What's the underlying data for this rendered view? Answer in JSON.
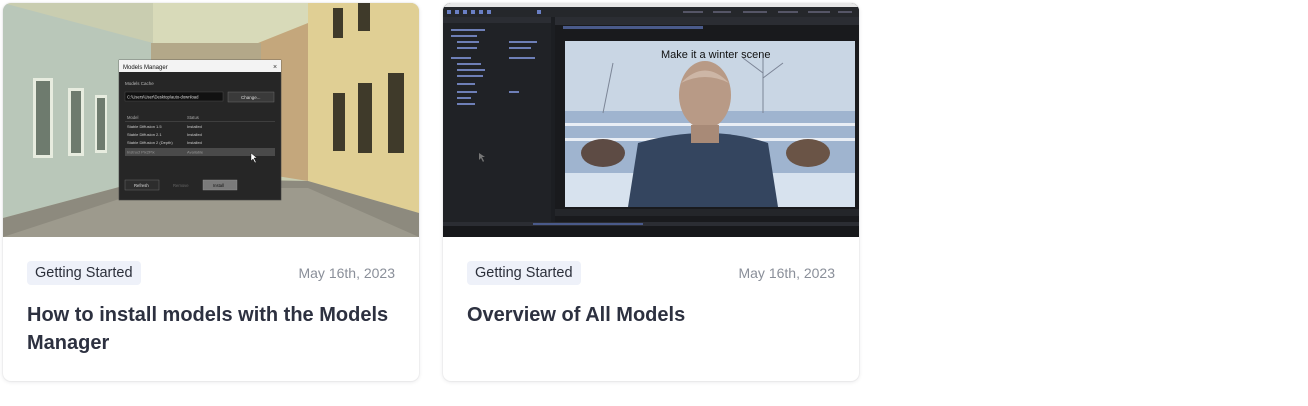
{
  "cards": [
    {
      "category": "Getting Started",
      "date": "May 16th, 2023",
      "title": "How to install models with the Models Manager",
      "thumbnail": {
        "dialog_title": "Models Manager",
        "cache_label": "Models Cache",
        "cache_path": "C:\\Users\\User\\Desktop\\auto-download",
        "change_button": "Change...",
        "col_model": "Model",
        "col_status": "Status",
        "rows": [
          {
            "model": "Stable Diffusion 1.5",
            "status": "Installed"
          },
          {
            "model": "Stable Diffusion 2.1",
            "status": "Installed"
          },
          {
            "model": "Stable Diffusion 2 (Depth)",
            "status": "Installed"
          },
          {
            "model": "Instruct Pix2Pix",
            "status": "Available"
          }
        ],
        "refresh_button": "Refresh",
        "remove_button": "Remove",
        "install_button": "Install"
      }
    },
    {
      "category": "Getting Started",
      "date": "May 16th, 2023",
      "title": "Overview of All Models",
      "thumbnail": {
        "prompt_text": "Make it a winter scene"
      }
    }
  ],
  "colors": {
    "badge_bg": "#eef1f9",
    "title": "#2d3140",
    "date": "#8a8f99"
  }
}
